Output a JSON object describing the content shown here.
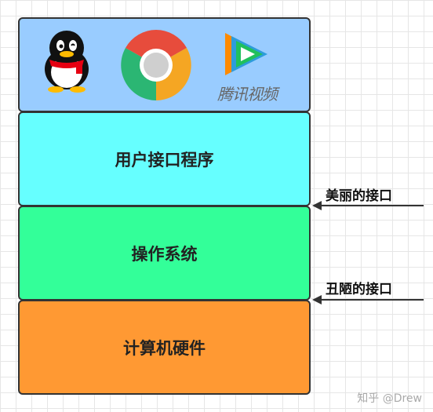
{
  "layers": {
    "apps": {
      "video_logo_text": "腾讯视频"
    },
    "user_interface": {
      "label": "用户接口程序"
    },
    "operating_system": {
      "label": "操作系统"
    },
    "hardware": {
      "label": "计算机硬件"
    }
  },
  "arrows": {
    "upper": {
      "label": "美丽的接口"
    },
    "lower": {
      "label": "丑陋的接口"
    }
  },
  "watermark": "知乎 @Drew",
  "colors": {
    "apps_layer": "#99ccff",
    "ui_layer": "#66ffff",
    "os_layer": "#33ff99",
    "hw_layer": "#ff9933"
  }
}
